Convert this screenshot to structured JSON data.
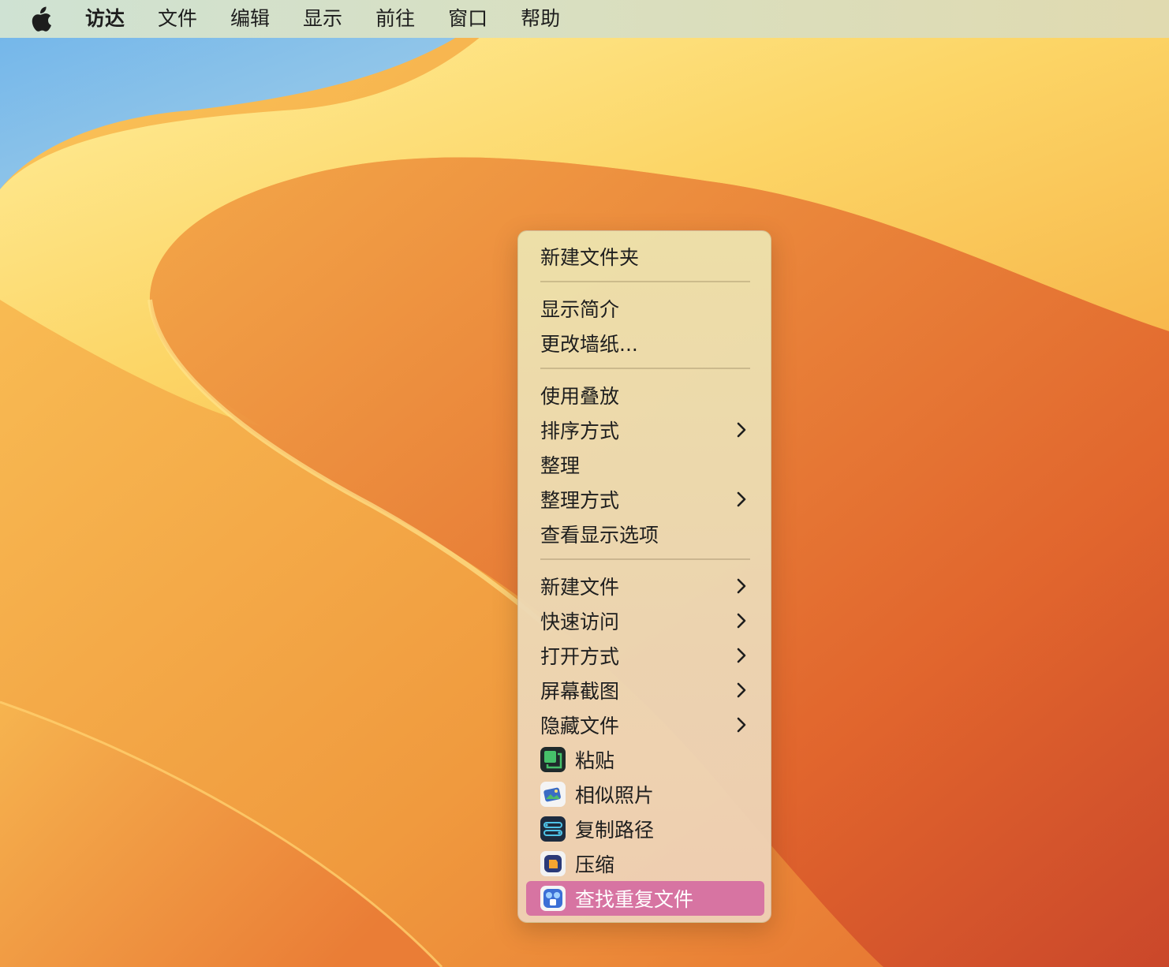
{
  "menubar": {
    "apple_icon": "apple-logo-icon",
    "items": [
      "访达",
      "文件",
      "编辑",
      "显示",
      "前往",
      "窗口",
      "帮助"
    ]
  },
  "context_menu": {
    "groups": [
      {
        "items": [
          {
            "label": "新建文件夹"
          }
        ]
      },
      {
        "items": [
          {
            "label": "显示简介"
          },
          {
            "label": "更改墙纸..."
          }
        ]
      },
      {
        "items": [
          {
            "label": "使用叠放"
          },
          {
            "label": "排序方式",
            "submenu": true
          },
          {
            "label": "整理"
          },
          {
            "label": "整理方式",
            "submenu": true
          },
          {
            "label": "查看显示选项"
          }
        ]
      },
      {
        "items": [
          {
            "label": "新建文件",
            "submenu": true
          },
          {
            "label": "快速访问",
            "submenu": true
          },
          {
            "label": "打开方式",
            "submenu": true
          },
          {
            "label": "屏幕截图",
            "submenu": true
          },
          {
            "label": "隐藏文件",
            "submenu": true
          },
          {
            "label": "粘贴",
            "icon": "paste-app-icon"
          },
          {
            "label": "相似照片",
            "icon": "similar-photos-app-icon"
          },
          {
            "label": "复制路径",
            "icon": "copy-path-app-icon"
          },
          {
            "label": "压缩",
            "icon": "compress-app-icon"
          },
          {
            "label": "查找重复文件",
            "icon": "find-duplicates-app-icon",
            "highlighted": true
          }
        ]
      }
    ]
  },
  "colors": {
    "highlight": "#d774a2",
    "menu_text": "#1e1e1e"
  }
}
